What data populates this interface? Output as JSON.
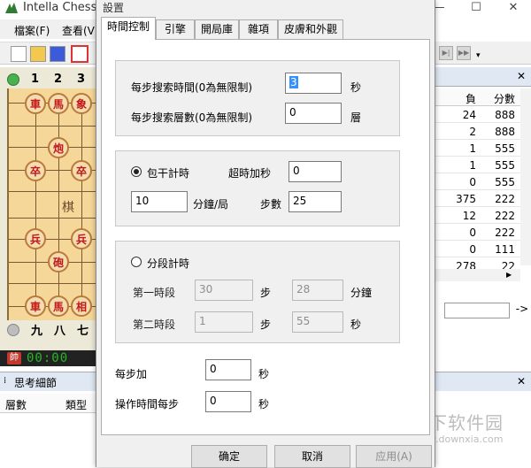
{
  "app": {
    "title": "Intella Chess",
    "menu": [
      "檔案(F)",
      "查看(V)"
    ],
    "board": {
      "top_files": [
        "1",
        "2",
        "3"
      ],
      "bottom_files": [
        "九",
        "八",
        "七"
      ],
      "river_text": "棋",
      "pieces": [
        {
          "label": "車",
          "side": "red"
        },
        {
          "label": "馬",
          "side": "red"
        },
        {
          "label": "象",
          "side": "red"
        },
        {
          "label": "炮",
          "side": "red"
        },
        {
          "label": "卒",
          "side": "red"
        },
        {
          "label": "卒",
          "side": "red"
        },
        {
          "label": "兵",
          "side": "red"
        },
        {
          "label": "兵",
          "side": "red"
        },
        {
          "label": "砲",
          "side": "red"
        },
        {
          "label": "車",
          "side": "red"
        },
        {
          "label": "馬",
          "side": "red"
        },
        {
          "label": "相",
          "side": "red"
        }
      ],
      "clock_text": "00:00"
    },
    "think_panel": {
      "title": "思考細節",
      "columns": [
        "層數",
        "類型"
      ]
    },
    "right_panel": {
      "columns": [
        "負",
        "分數"
      ],
      "rows": [
        [
          "24",
          "888"
        ],
        [
          "2",
          "888"
        ],
        [
          "1",
          "555"
        ],
        [
          "1",
          "555"
        ],
        [
          "0",
          "555"
        ],
        [
          "375",
          "222"
        ],
        [
          "12",
          "222"
        ],
        [
          "0",
          "222"
        ],
        [
          "0",
          "111"
        ],
        [
          "278",
          "22"
        ]
      ],
      "go_label": "->"
    },
    "watermark": {
      "name": "当下软件园",
      "url": "www.downxia.com"
    }
  },
  "dialog": {
    "title": "設置",
    "tabs": [
      "時間控制",
      "引擎",
      "開局庫",
      "雜項",
      "皮膚和外觀"
    ],
    "active_tab": 0,
    "group1": {
      "time_per_move_label": "每步搜索時間(0為無限制)",
      "time_per_move_value": "3",
      "time_per_move_unit": "秒",
      "depth_label": "每步搜索層數(0為無限制)",
      "depth_value": "0",
      "depth_unit": "層"
    },
    "group2": {
      "radio_label": "包干計時",
      "selected": true,
      "increment_label": "超時加秒",
      "increment_value": "0",
      "minutes_value": "10",
      "minutes_unit": "分鐘/局",
      "moves_label": "步數",
      "moves_value": "25"
    },
    "group3": {
      "radio_label": "分段計時",
      "selected": false,
      "stage1_label": "第一時段",
      "stage1_moves": "30",
      "stage1_moves_unit": "步",
      "stage1_minutes": "28",
      "stage1_minutes_unit": "分鐘",
      "stage2_label": "第二時段",
      "stage2_moves": "1",
      "stage2_moves_unit": "步",
      "stage2_seconds": "55",
      "stage2_seconds_unit": "秒"
    },
    "extra": {
      "add_per_move_label": "每步加",
      "add_per_move_value": "0",
      "add_per_move_unit": "秒",
      "op_time_label": "操作時間每步",
      "op_time_value": "0",
      "op_time_unit": "秒"
    },
    "buttons": {
      "ok": "确定",
      "cancel": "取消",
      "apply": "应用(A)"
    }
  }
}
